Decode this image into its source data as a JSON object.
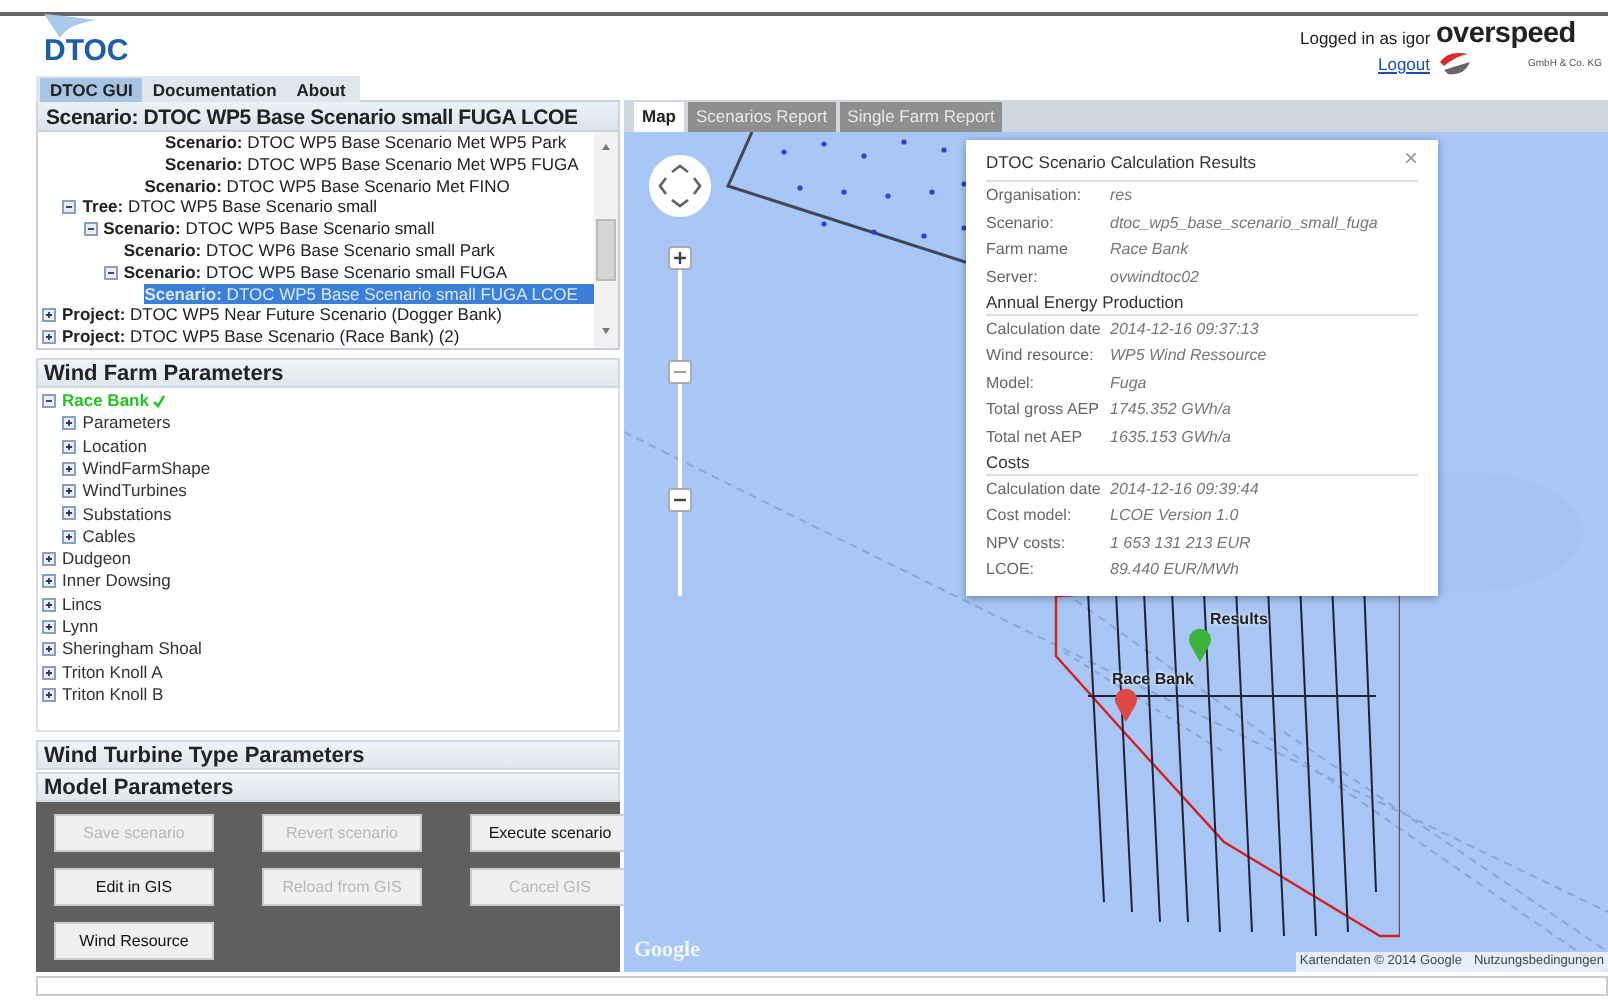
{
  "header": {
    "logo": "DTOC",
    "tabs": [
      {
        "label": "DTOC GUI",
        "selected": true
      },
      {
        "label": "Documentation",
        "selected": false
      },
      {
        "label": "About",
        "selected": false
      }
    ],
    "user": "Logged in as igor",
    "logout": "Logout",
    "brand": {
      "name": "overspeed",
      "subtitle": "GmbH & Co. KG"
    }
  },
  "scenario_panel": {
    "title": "Scenario: DTOC WP5 Base Scenario small FUGA LCOE",
    "items": [
      {
        "children": [
          {
            "children": [
              {
                "children": [
                  {
                    "children": [
                      {
                        "children": [
                          {
                            "label": "**Scenario:** DTOC WP5 Base Scenario Met WP5 Park",
                            "selected": false
                          },
                          {
                            "label": "**Scenario:** DTOC WP5 Base Scenario Met WP5 FUGA",
                            "selected": false
                          }
                        ]
                      },
                      {
                        "label": "**Scenario:** DTOC WP5 Base Scenario Met FINO",
                        "selected": false
                      }
                    ]
                  }
                ]
              }
            ]
          },
          {
            "label": "**Tree:** DTOC WP5 Base Scenario small",
            "expanded": true,
            "selected": false,
            "children": [
              {
                "label": "**Scenario:** DTOC WP5 Base Scenario small",
                "expanded": true,
                "selected": false,
                "children": [
                  {
                    "label": "**Scenario:** DTOC WP6 Base Scenario small Park",
                    "selected": false
                  },
                  {
                    "label": "**Scenario:** DTOC WP5 Base Scenario small FUGA",
                    "expanded": true,
                    "selected": false,
                    "children": [
                      {
                        "label": "**Scenario:** DTOC WP5 Base Scenario small FUGA LCOE",
                        "selected": true
                      }
                    ]
                  }
                ]
              }
            ]
          }
        ]
      },
      {
        "label": "**Project:** DTOC WP5 Near Future Scenario (Dogger Bank)",
        "expanded": false,
        "selected": false
      },
      {
        "label": "**Project:** DTOC WP5 Base Scenario (Race Bank) (2)",
        "expanded": false,
        "selected": false
      }
    ]
  },
  "wind_farm_parameters": {
    "title": "Wind Farm Parameters",
    "items": [
      {
        "label": "Race Bank",
        "valid": true,
        "expanded": true,
        "children": [
          {
            "label": "Parameters",
            "expanded": false
          },
          {
            "label": "Location",
            "expanded": false
          },
          {
            "label": "WindFarmShape",
            "expanded": false
          },
          {
            "label": "WindTurbines",
            "expanded": false
          },
          {
            "label": "Substations",
            "expanded": false
          },
          {
            "label": "Cables",
            "expanded": false
          }
        ]
      },
      {
        "label": "Dudgeon",
        "expanded": false
      },
      {
        "label": "Inner Dowsing",
        "expanded": false
      },
      {
        "label": "Lincs",
        "expanded": false
      },
      {
        "label": "Lynn",
        "expanded": false
      },
      {
        "label": "Sheringham Shoal",
        "expanded": false
      },
      {
        "label": "Triton Knoll A",
        "expanded": false
      },
      {
        "label": "Triton Knoll B",
        "expanded": false
      }
    ]
  },
  "collapsed_panels": [
    "Wind Turbine Type Parameters",
    "Model Parameters"
  ],
  "buttons": [
    {
      "label": "Save scenario",
      "disabled": true
    },
    {
      "label": "Revert scenario",
      "disabled": true
    },
    {
      "label": "Execute scenario",
      "disabled": false
    },
    {
      "label": "Edit in GIS",
      "disabled": false
    },
    {
      "label": "Reload from GIS",
      "disabled": true
    },
    {
      "label": "Cancel GIS",
      "disabled": true
    },
    {
      "label": "Wind Resource",
      "disabled": false
    }
  ],
  "map": {
    "tabs": [
      {
        "label": "Map",
        "selected": true
      },
      {
        "label": "Scenarios Report",
        "selected": false
      },
      {
        "label": "Single Farm Report",
        "selected": false
      }
    ],
    "markers": [
      {
        "label": "Results",
        "color": "#3cb43c"
      },
      {
        "label": "Race Bank",
        "color": "#e04848"
      }
    ],
    "popup": {
      "title": "DTOC Scenario Calculation Results",
      "close": "×",
      "sections": [
        {
          "rows": [
            {
              "label": "Organisation:",
              "value": "res"
            },
            {
              "label": "Scenario:",
              "value": "dtoc_wp5_base_scenario_small_fuga"
            },
            {
              "label": "Farm name",
              "value": "Race Bank"
            },
            {
              "label": "Server:",
              "value": "ovwindtoc02"
            }
          ]
        },
        {
          "heading": "Annual Energy Production",
          "rows": [
            {
              "label": "Calculation date",
              "value": "2014-12-16 09:37:13"
            },
            {
              "label": "Wind resource:",
              "value": "WP5 Wind Ressource"
            },
            {
              "label": "Model:",
              "value": "Fuga"
            },
            {
              "label": "Total gross AEP",
              "value": "1745.352 GWh/a"
            },
            {
              "label": "Total net AEP",
              "value": "1635.153 GWh/a"
            }
          ]
        },
        {
          "heading": "Costs",
          "rows": [
            {
              "label": "Calculation date",
              "value": "2014-12-16 09:39:44"
            },
            {
              "label": "Cost model:",
              "value": "LCOE Version 1.0"
            },
            {
              "label": "NPV costs:",
              "value": "1 653 131 213 EUR"
            },
            {
              "label": "LCOE:",
              "value": "89.440 EUR/MWh"
            }
          ]
        }
      ]
    },
    "google_logo": "Google",
    "attribution": "Kartendaten © 2014 Google",
    "terms": "Nutzungsbedingungen"
  }
}
